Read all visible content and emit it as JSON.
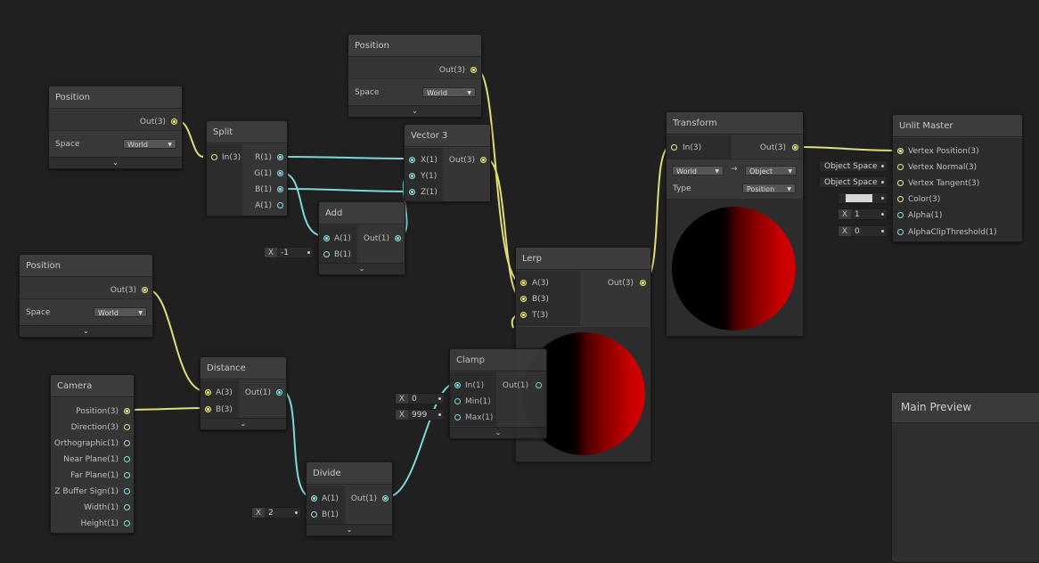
{
  "colors": {
    "vector_port": "#f0f07c",
    "float_port": "#84e4e7",
    "canvas": "#202020",
    "node": "#393939"
  },
  "nodes": {
    "position_a": {
      "title": "Position",
      "out": "Out(3)",
      "space_label": "Space",
      "space_value": "World"
    },
    "position_b": {
      "title": "Position",
      "out": "Out(3)",
      "space_label": "Space",
      "space_value": "World"
    },
    "position_c": {
      "title": "Position",
      "out": "Out(3)",
      "space_label": "Space",
      "space_value": "World"
    },
    "split": {
      "title": "Split",
      "in": "In(3)",
      "outs": [
        "R(1)",
        "G(1)",
        "B(1)",
        "A(1)"
      ]
    },
    "vector3": {
      "title": "Vector 3",
      "ins": [
        "X(1)",
        "Y(1)",
        "Z(1)"
      ],
      "out": "Out(3)"
    },
    "add": {
      "title": "Add",
      "ins": [
        "A(1)",
        "B(1)"
      ],
      "out": "Out(1)",
      "b_field": {
        "label": "X",
        "value": "-1"
      }
    },
    "lerp": {
      "title": "Lerp",
      "ins": [
        "A(3)",
        "B(3)",
        "T(3)"
      ],
      "out": "Out(3)"
    },
    "transform": {
      "title": "Transform",
      "in": "In(3)",
      "out": "Out(3)",
      "from": "World",
      "arrow": "→",
      "to": "Object",
      "type_label": "Type",
      "type_value": "Position"
    },
    "unlit": {
      "title": "Unlit Master",
      "ins": [
        "Vertex Position(3)",
        "Vertex Normal(3)",
        "Vertex Tangent(3)",
        "Color(3)",
        "Alpha(1)",
        "AlphaClipThreshold(1)"
      ],
      "normal_field": "Object Space",
      "tangent_field": "Object Space",
      "alpha_field": {
        "label": "X",
        "value": "1"
      },
      "clip_field": {
        "label": "X",
        "value": "0"
      }
    },
    "camera": {
      "title": "Camera",
      "outs": [
        "Position(3)",
        "Direction(3)",
        "Orthographic(1)",
        "Near Plane(1)",
        "Far Plane(1)",
        "Z Buffer Sign(1)",
        "Width(1)",
        "Height(1)"
      ]
    },
    "distance": {
      "title": "Distance",
      "ins": [
        "A(3)",
        "B(3)"
      ],
      "out": "Out(1)"
    },
    "divide": {
      "title": "Divide",
      "ins": [
        "A(1)",
        "B(1)"
      ],
      "out": "Out(1)",
      "b_field": {
        "label": "X",
        "value": "2"
      }
    },
    "clamp": {
      "title": "Clamp",
      "ins": [
        "In(1)",
        "Min(1)",
        "Max(1)"
      ],
      "out": "Out(1)",
      "min_field": {
        "label": "X",
        "value": "0"
      },
      "max_field": {
        "label": "X",
        "value": "999"
      }
    }
  },
  "main_preview": {
    "title": "Main Preview"
  },
  "icons": {
    "collapse": "chevron-down-icon",
    "dropdown": "triangle-down-icon",
    "connector": "port-icon"
  }
}
